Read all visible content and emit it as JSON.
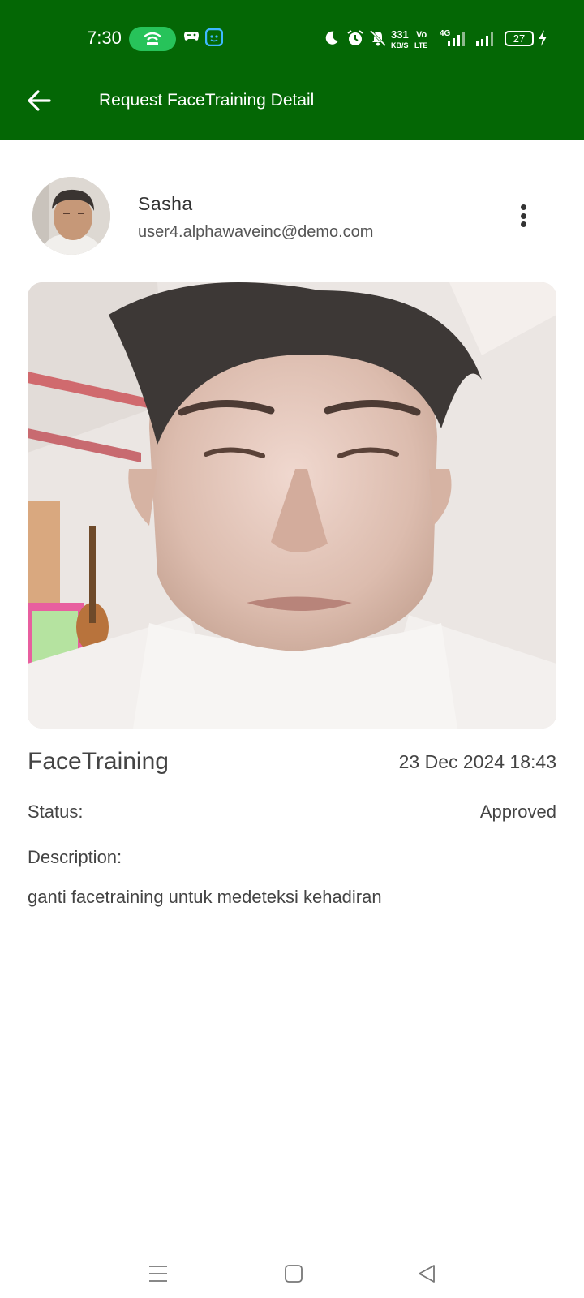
{
  "status_bar": {
    "time": "7:30",
    "net_speed_value": "331",
    "net_speed_unit": "KB/S",
    "volte_top": "Vo",
    "volte_bottom": "LTE",
    "network_type": "4G",
    "battery_level": "27",
    "icons": [
      "hotspot-icon",
      "game-controller-icon",
      "app-icon",
      "moon-icon",
      "alarm-icon",
      "mute-icon",
      "signal-icon",
      "signal-icon",
      "battery-icon",
      "charging-icon"
    ]
  },
  "appbar": {
    "title": "Request FaceTraining Detail",
    "back_icon": "arrow-left-icon",
    "color": "#046705"
  },
  "user": {
    "name": "Sasha",
    "email": "user4.alphawaveinc@demo.com",
    "menu_icon": "more-vertical-icon"
  },
  "request": {
    "type": "FaceTraining",
    "datetime": "23 Dec 2024 18:43",
    "status_label": "Status:",
    "status_value": "Approved",
    "description_label": "Description:",
    "description_value": "ganti facetraining untuk medeteksi kehadiran"
  },
  "nav_bar": {
    "icons": [
      "menu-icon",
      "home-square-icon",
      "back-triangle-icon"
    ]
  }
}
